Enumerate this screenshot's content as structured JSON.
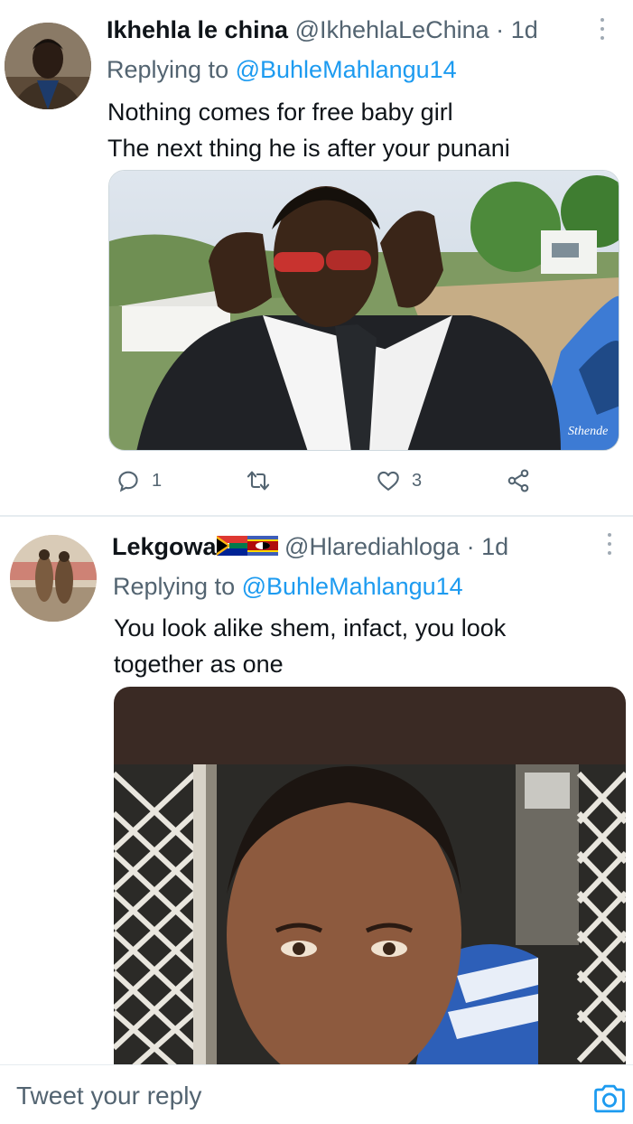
{
  "tweets": [
    {
      "author_name": "Ikhehla le china",
      "author_handle": "@IkhehlaLeChina",
      "separator": "·",
      "time": "1d",
      "replying_label": "Replying to",
      "replying_to": "@BuhleMahlangu14",
      "text_lines": [
        "Nothing comes for free baby girl",
        "The next thing he is after your punani"
      ],
      "media_watermark": "Sthende",
      "reply_count": "1",
      "retweet_count": "",
      "like_count": "3",
      "icons": [
        "reply-icon",
        "retweet-icon",
        "like-icon",
        "share-icon"
      ]
    },
    {
      "author_name": "Lekgowa",
      "author_flags": [
        "south-africa-flag",
        "eswatini-flag"
      ],
      "author_handle": "@Hlarediahloga",
      "separator": "·",
      "time": "1d",
      "replying_label": "Replying to",
      "replying_to": "@BuhleMahlangu14",
      "text_lines": [
        "You look alike shem, infact, you look",
        "together as one"
      ]
    }
  ],
  "compose": {
    "placeholder": "Tweet your reply",
    "camera_icon": "camera-icon"
  },
  "colors": {
    "accent": "#1d9bf0",
    "secondary_text": "#536471",
    "primary_text": "#0f1419",
    "divider": "#e6ecf0"
  }
}
